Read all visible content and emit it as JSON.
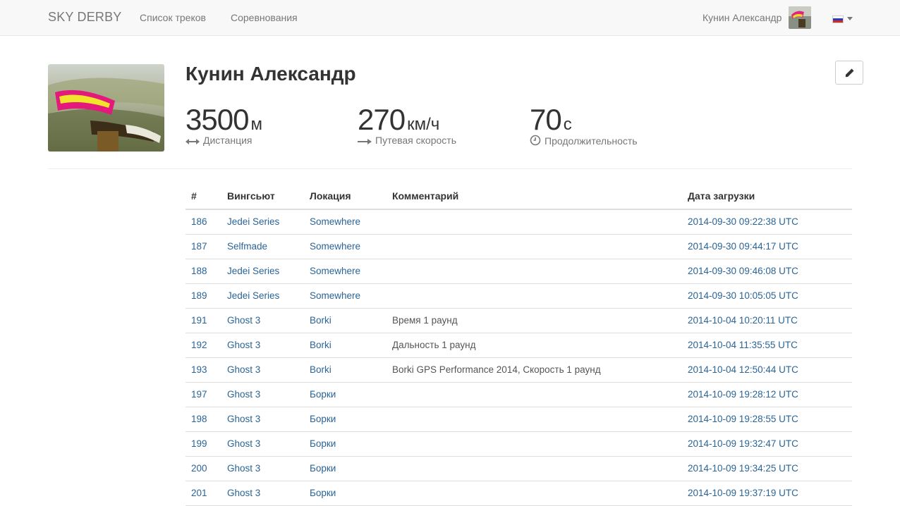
{
  "navbar": {
    "brand": "SKY DERBY",
    "links": [
      "Список треков",
      "Соревнования"
    ],
    "user_name": "Кунин Александр",
    "language_flag": "russian-flag-icon"
  },
  "profile": {
    "name": "Кунин Александр",
    "stats": [
      {
        "value": "3500",
        "unit": "м",
        "label": "Дистанция",
        "icon": "arrows-horizontal-icon"
      },
      {
        "value": "270",
        "unit": "км/ч",
        "label": "Путевая скорость",
        "icon": "arrow-right-icon"
      },
      {
        "value": "70",
        "unit": "с",
        "label": "Продолжительность",
        "icon": "clock-icon"
      }
    ],
    "edit_icon": "pencil-icon"
  },
  "table": {
    "headers": [
      "#",
      "Вингсьют",
      "Локация",
      "Комментарий",
      "Дата загрузки"
    ],
    "rows": [
      {
        "id": "186",
        "suit": "Jedei Series",
        "place": "Somewhere",
        "comment": "",
        "date": "2014-09-30 09:22:38 UTC"
      },
      {
        "id": "187",
        "suit": "Selfmade",
        "place": "Somewhere",
        "comment": "",
        "date": "2014-09-30 09:44:17 UTC"
      },
      {
        "id": "188",
        "suit": "Jedei Series",
        "place": "Somewhere",
        "comment": "",
        "date": "2014-09-30 09:46:08 UTC"
      },
      {
        "id": "189",
        "suit": "Jedei Series",
        "place": "Somewhere",
        "comment": "",
        "date": "2014-09-30 10:05:05 UTC"
      },
      {
        "id": "191",
        "suit": "Ghost 3",
        "place": "Borki",
        "comment": "Время 1 раунд",
        "date": "2014-10-04 10:20:11 UTC"
      },
      {
        "id": "192",
        "suit": "Ghost 3",
        "place": "Borki",
        "comment": "Дальность 1 раунд",
        "date": "2014-10-04 11:35:55 UTC"
      },
      {
        "id": "193",
        "suit": "Ghost 3",
        "place": "Borki",
        "comment": "Borki GPS Performance 2014, Скорость 1 раунд",
        "date": "2014-10-04 12:50:44 UTC"
      },
      {
        "id": "197",
        "suit": "Ghost 3",
        "place": "Борки",
        "comment": "",
        "date": "2014-10-09 19:28:12 UTC"
      },
      {
        "id": "198",
        "suit": "Ghost 3",
        "place": "Борки",
        "comment": "",
        "date": "2014-10-09 19:28:55 UTC"
      },
      {
        "id": "199",
        "suit": "Ghost 3",
        "place": "Борки",
        "comment": "",
        "date": "2014-10-09 19:32:47 UTC"
      },
      {
        "id": "200",
        "suit": "Ghost 3",
        "place": "Борки",
        "comment": "",
        "date": "2014-10-09 19:34:25 UTC"
      },
      {
        "id": "201",
        "suit": "Ghost 3",
        "place": "Борки",
        "comment": "",
        "date": "2014-10-09 19:37:19 UTC"
      }
    ]
  },
  "colors": {
    "link": "#2a6496",
    "navbar_bg": "#f8f8f8",
    "muted_text": "#777777"
  }
}
